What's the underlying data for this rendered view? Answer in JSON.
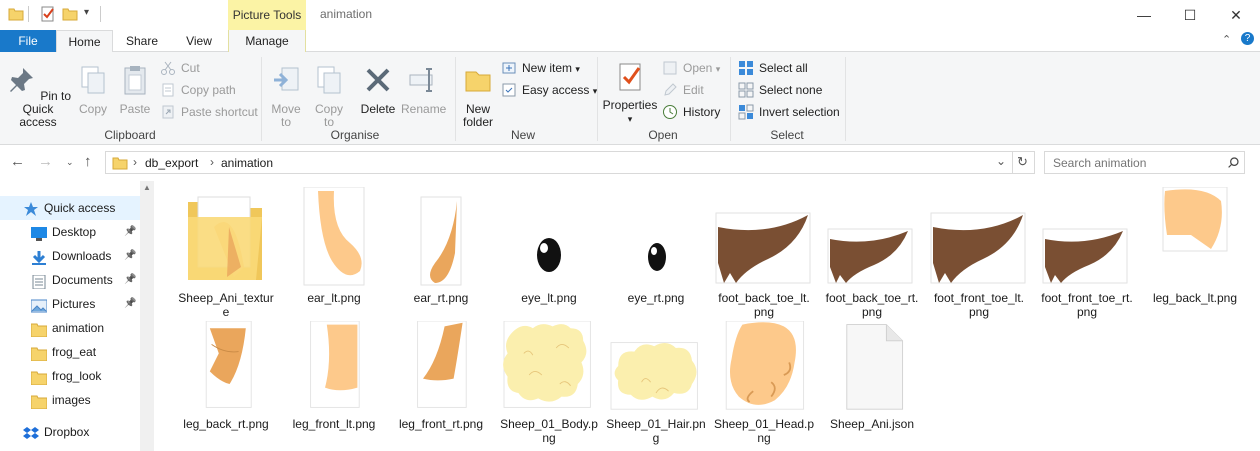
{
  "titlebar": {
    "contextual_tab": "Picture Tools",
    "window_title": "animation",
    "minimize": "—",
    "maximize": "☐",
    "close": "✕"
  },
  "tabs": {
    "file": "File",
    "home": "Home",
    "share": "Share",
    "view": "View",
    "manage": "Manage"
  },
  "ribbon": {
    "clipboard": {
      "label": "Clipboard",
      "pin": "Pin to Quick\naccess",
      "copy": "Copy",
      "paste": "Paste",
      "cut": "Cut",
      "copy_path": "Copy path",
      "paste_shortcut": "Paste shortcut"
    },
    "organise": {
      "label": "Organise",
      "move_to": "Move\nto",
      "copy_to": "Copy\nto",
      "delete": "Delete",
      "rename": "Rename"
    },
    "new": {
      "label": "New",
      "new_folder": "New\nfolder",
      "new_item": "New item",
      "easy_access": "Easy access"
    },
    "open": {
      "label": "Open",
      "properties": "Properties",
      "open": "Open",
      "edit": "Edit",
      "history": "History"
    },
    "select": {
      "label": "Select",
      "select_all": "Select all",
      "select_none": "Select none",
      "invert": "Invert selection"
    }
  },
  "address": {
    "crumbs": [
      "db_export",
      "animation"
    ],
    "search_placeholder": "Search animation"
  },
  "nav": {
    "items": [
      {
        "label": "Quick access",
        "icon": "star-icon"
      },
      {
        "label": "Desktop",
        "icon": "desktop-icon",
        "pinned": true
      },
      {
        "label": "Downloads",
        "icon": "downloads-icon",
        "pinned": true
      },
      {
        "label": "Documents",
        "icon": "documents-icon",
        "pinned": true
      },
      {
        "label": "Pictures",
        "icon": "pictures-icon",
        "pinned": true
      },
      {
        "label": "animation",
        "icon": "folder-icon"
      },
      {
        "label": "frog_eat",
        "icon": "folder-icon"
      },
      {
        "label": "frog_look",
        "icon": "folder-icon"
      },
      {
        "label": "images",
        "icon": "folder-icon"
      },
      {
        "label": "Dropbox",
        "icon": "dropbox-icon"
      }
    ]
  },
  "files": [
    {
      "name": "Sheep_Ani_textur\ne",
      "kind": "folder"
    },
    {
      "name": "ear_lt.png",
      "kind": "ear_lt"
    },
    {
      "name": "ear_rt.png",
      "kind": "ear_rt"
    },
    {
      "name": "eye_lt.png",
      "kind": "eye"
    },
    {
      "name": "eye_rt.png",
      "kind": "eye_small"
    },
    {
      "name": "foot_back_toe_lt.\npng",
      "kind": "hoof"
    },
    {
      "name": "foot_back_toe_rt.\npng",
      "kind": "hoof_small"
    },
    {
      "name": "foot_front_toe_lt.\npng",
      "kind": "hoof"
    },
    {
      "name": "foot_front_toe_rt.\npng",
      "kind": "hoof_small"
    },
    {
      "name": "leg_back_lt.png",
      "kind": "leg_back_lt"
    },
    {
      "name": "leg_back_rt.png",
      "kind": "leg_back_rt"
    },
    {
      "name": "leg_front_lt.png",
      "kind": "leg_front_lt"
    },
    {
      "name": "leg_front_rt.png",
      "kind": "leg_front_rt"
    },
    {
      "name": "Sheep_01_Body.p\nng",
      "kind": "body"
    },
    {
      "name": "Sheep_01_Hair.pn\ng",
      "kind": "hair"
    },
    {
      "name": "Sheep_01_Head.p\nng",
      "kind": "head"
    },
    {
      "name": "Sheep_Ani.json",
      "kind": "json"
    }
  ],
  "colors": {
    "accent": "#1979ca",
    "contextual": "#fbf3a5",
    "skin_light": "#fdc98b",
    "skin_dark": "#eaa65c",
    "hoof": "#7a4f33",
    "wool": "#fbefae"
  }
}
